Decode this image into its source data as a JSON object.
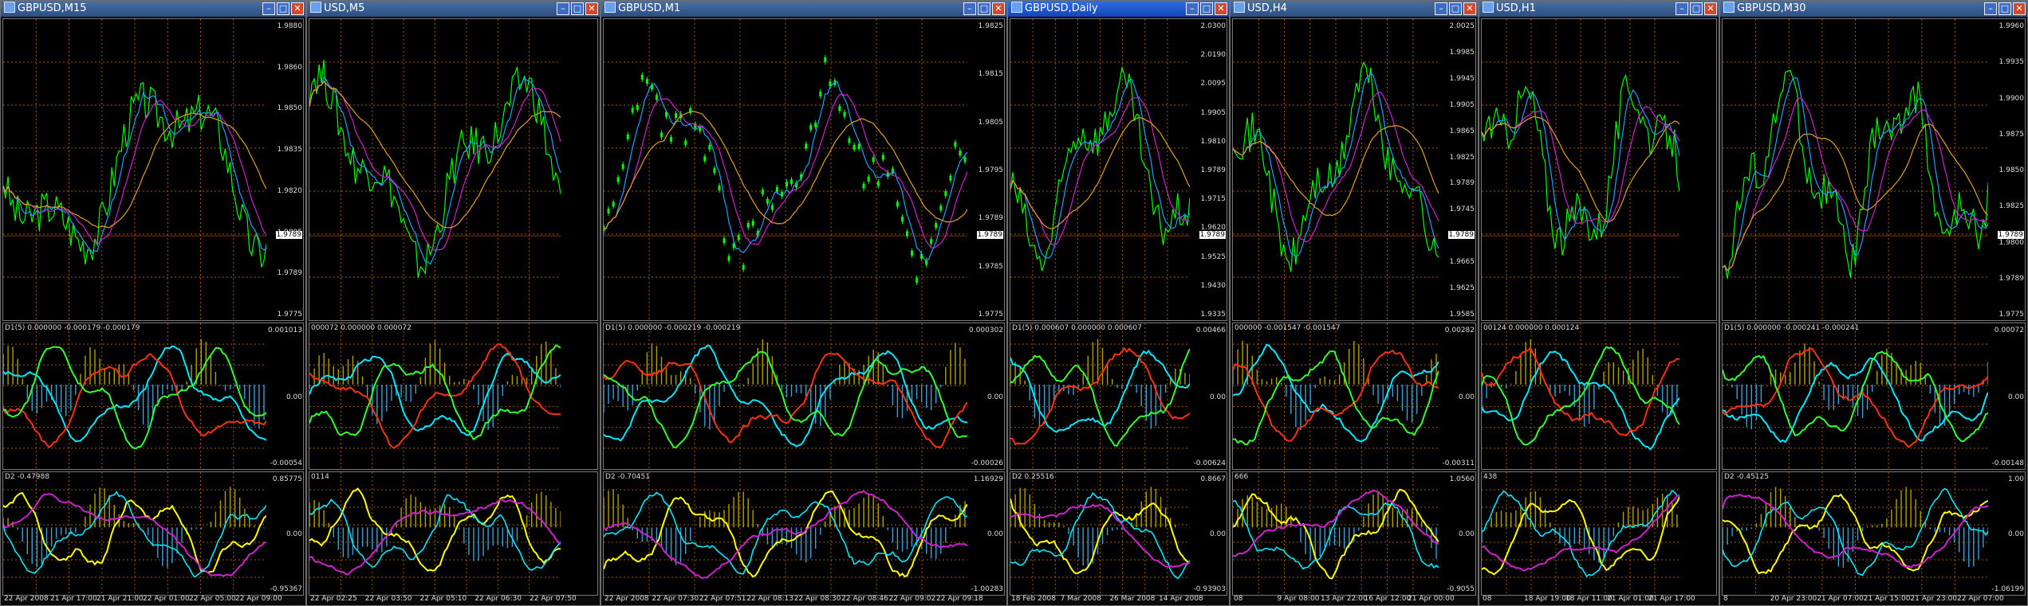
{
  "charts": [
    {
      "title": "GBPUSD,M15",
      "active": false,
      "price_ticks": [
        "1.9880",
        "1.9860",
        "1.9850",
        "1.9835",
        "1.9820",
        "1.9805",
        "1.9789",
        "1.9775"
      ],
      "current_price": "1.9789",
      "ind1_info": "D1(5) 0.000000 -0.000179 -0.000179",
      "ind1_ticks": [
        "0.001013",
        "0.00",
        "-0.00054"
      ],
      "ind2_info": "D2 -0.47988",
      "ind2_ticks": [
        "0.85775",
        "0.00",
        "-0.95367"
      ],
      "time_labels": [
        "22 Apr 2008",
        "21 Apr 17:00",
        "21 Apr 21:00",
        "22 Apr 01:00",
        "22 Apr 05:00",
        "22 Apr 09:00"
      ]
    },
    {
      "title": "USD,M5",
      "active": false,
      "price_ticks": [],
      "current_price": "",
      "ind1_info": "000072 0.000000 0.000072",
      "ind1_ticks": [],
      "ind2_info": "0114",
      "ind2_ticks": [],
      "time_labels": [
        "22 Apr 02:25",
        "22 Apr 03:50",
        "22 Apr 05:10",
        "22 Apr 06:30",
        "22 Apr 07:50"
      ]
    },
    {
      "title": "GBPUSD,M1",
      "active": false,
      "price_ticks": [
        "1.9825",
        "1.9815",
        "1.9805",
        "1.9795",
        "1.9789",
        "1.9785",
        "1.9775"
      ],
      "current_price": "1.9789",
      "ind1_info": "D1(5) 0.000000 -0.000219 -0.000219",
      "ind1_ticks": [
        "0.000302",
        "0.00",
        "-0.00026"
      ],
      "ind2_info": "D2 -0.70451",
      "ind2_ticks": [
        "1.16929",
        "0.00",
        "-1.00283"
      ],
      "time_labels": [
        "22 Apr 2008",
        "22 Apr 07:30",
        "22 Apr 07:51",
        "22 Apr 08:13",
        "22 Apr 08:30",
        "22 Apr 08:46",
        "22 Apr 09:02",
        "22 Apr 09:18"
      ]
    },
    {
      "title": "GBPUSD,Daily",
      "active": true,
      "price_ticks": [
        "2.0300",
        "2.0190",
        "2.0095",
        "1.9905",
        "1.9810",
        "1.9789",
        "1.9715",
        "1.9620",
        "1.9525",
        "1.9430",
        "1.9335"
      ],
      "current_price": "1.9789",
      "ind1_info": "D1(5) 0.000607 0.000000 0.000607",
      "ind1_ticks": [
        "0.00466",
        "0.00",
        "-0.00624"
      ],
      "ind2_info": "D2 0.25516",
      "ind2_ticks": [
        "0.8667",
        "0.00",
        "-0.93903"
      ],
      "time_labels": [
        "18 Feb 2008",
        "7 Mar 2008",
        "26 Mar 2008",
        "14 Apr 2008"
      ]
    },
    {
      "title": "USD,H4",
      "active": false,
      "price_ticks": [
        "2.0025",
        "1.9985",
        "1.9945",
        "1.9905",
        "1.9865",
        "1.9825",
        "1.9789",
        "1.9745",
        "1.9705",
        "1.9665",
        "1.9625",
        "1.9585"
      ],
      "current_price": "1.9789",
      "ind1_info": "000000 -0.001547 -0.001547",
      "ind1_ticks": [
        "0.00282",
        "0.00",
        "-0.00311"
      ],
      "ind2_info": "666",
      "ind2_ticks": [
        "1.0560",
        "0.00",
        "-0.9055"
      ],
      "time_labels": [
        "08",
        "9 Apr 08:00",
        "13 Apr 22:00",
        "16 Apr 12:00",
        "21 Apr 00:00"
      ]
    },
    {
      "title": "USD,H1",
      "active": false,
      "price_ticks": [],
      "current_price": "",
      "ind1_info": "00124 0.000000 0.000124",
      "ind1_ticks": [],
      "ind2_info": "438",
      "ind2_ticks": [],
      "time_labels": [
        "08",
        "18 Apr 19:00",
        "18 Apr 11:00",
        "21 Apr 01:00",
        "21 Apr 17:00"
      ]
    },
    {
      "title": "GBPUSD,M30",
      "active": false,
      "price_ticks": [
        "1.9960",
        "1.9935",
        "1.9900",
        "1.9875",
        "1.9850",
        "1.9825",
        "1.9800",
        "1.9789",
        "1.9775"
      ],
      "current_price": "1.9789",
      "ind1_info": "D1(5) 0.000000 -0.000241 -0.000241",
      "ind1_ticks": [
        "0.00072",
        "0.00",
        "-0.00148"
      ],
      "ind2_info": "D2 -0.45125",
      "ind2_ticks": [
        "1.00",
        "0.00",
        "-1.06199"
      ],
      "time_labels": [
        "8",
        "20 Apr 23:00",
        "21 Apr 07:00",
        "21 Apr 15:00",
        "21 Apr 23:00",
        "22 Apr 07:00"
      ]
    }
  ],
  "colors": {
    "candle": "#00ff00",
    "ma_blue": "#1fa0ff",
    "ma_magenta": "#d020d0",
    "ma_gold": "#e0a020",
    "osc_cyan": "#00e8ff",
    "osc_red": "#ff3010",
    "osc_green": "#30ff30",
    "osc_yellow": "#ffff00",
    "hist_olive": "#b0a000",
    "hist_blue": "#3aa0d8",
    "grid": "#a05a00"
  }
}
